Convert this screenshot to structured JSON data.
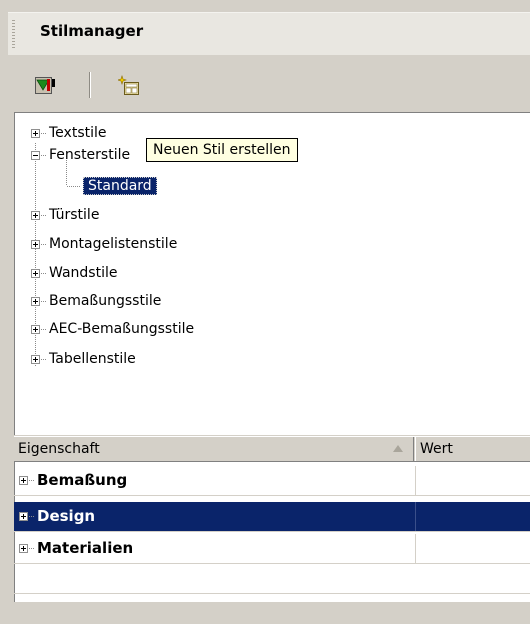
{
  "window": {
    "title": "Stilmanager"
  },
  "toolbar": {
    "buttons": [
      {
        "icon": "filter-style-icon"
      },
      {
        "icon": "new-style-icon"
      }
    ]
  },
  "tree": {
    "nodes": [
      {
        "label": "Textstile",
        "expanded": false
      },
      {
        "label": "Fensterstile",
        "expanded": true,
        "children": [
          {
            "label": "Standard",
            "selected": true
          }
        ]
      },
      {
        "label": "Türstile",
        "expanded": false
      },
      {
        "label": "Montagelistenstile",
        "expanded": false
      },
      {
        "label": "Wandstile",
        "expanded": false
      },
      {
        "label": "Bemaßungsstile",
        "expanded": false
      },
      {
        "label": "AEC-Bemaßungsstile",
        "expanded": false
      },
      {
        "label": "Tabellenstile",
        "expanded": false
      }
    ]
  },
  "tooltip": {
    "text": "Neuen Stil erstellen"
  },
  "properties": {
    "columns": [
      "Eigenschaft",
      "Wert"
    ],
    "rows": [
      {
        "label": "Bemaßung",
        "selected": false
      },
      {
        "label": "Design",
        "selected": true
      },
      {
        "label": "Materialien",
        "selected": false
      }
    ]
  },
  "colors": {
    "selection": "#0a246a",
    "tooltip_bg": "#ffffe1",
    "panel": "#d4d0c8"
  }
}
